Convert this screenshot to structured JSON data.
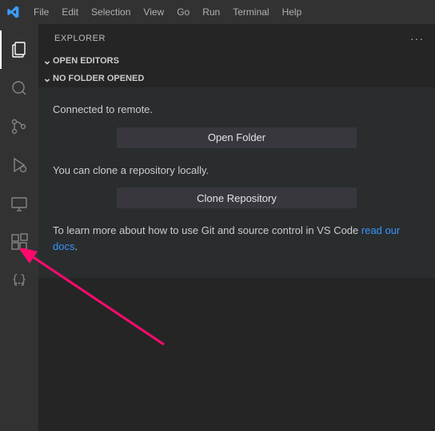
{
  "menu": [
    "File",
    "Edit",
    "Selection",
    "View",
    "Go",
    "Run",
    "Terminal",
    "Help"
  ],
  "sidebar": {
    "title": "EXPLORER",
    "sections": {
      "openEditors": "OPEN EDITORS",
      "noFolder": "NO FOLDER OPENED"
    },
    "body": {
      "connected": "Connected to remote.",
      "openFolderBtn": "Open Folder",
      "cloneMsg": "You can clone a repository locally.",
      "cloneBtn": "Clone Repository",
      "learnPrefix": "To learn more about how to use Git and source control in VS Code ",
      "learnLink": "read our docs",
      "learnSuffix": "."
    }
  },
  "activityIcons": [
    "explorer",
    "search",
    "source-control",
    "run-debug",
    "remote-explorer",
    "extensions",
    "json-outline"
  ]
}
